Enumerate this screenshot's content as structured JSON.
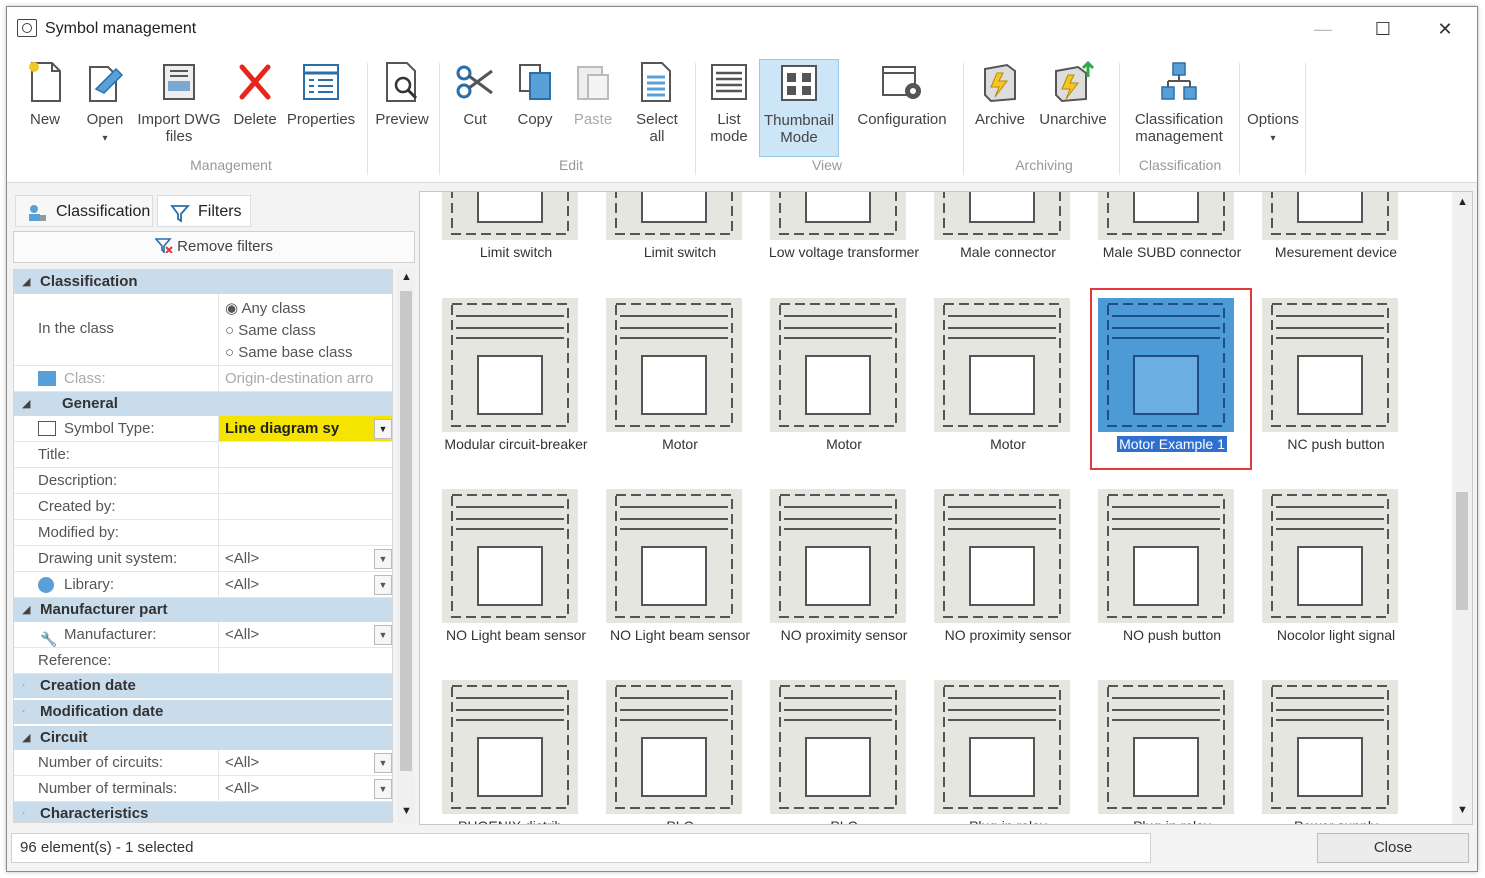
{
  "window": {
    "title": "Symbol management",
    "minimize": "—",
    "maximize": "☐",
    "close": "✕"
  },
  "ribbon": {
    "buttons": [
      {
        "label": "New",
        "icon": "new-file-icon"
      },
      {
        "label": "Open",
        "icon": "open-icon",
        "dropdown": "▾"
      },
      {
        "label": "Import DWG files",
        "icon": "import-dwg-icon"
      },
      {
        "label": "Delete",
        "icon": "delete-icon"
      },
      {
        "label": "Properties",
        "icon": "properties-icon"
      },
      {
        "label": "Preview",
        "icon": "preview-icon"
      },
      {
        "label": "Cut",
        "icon": "scissors-icon"
      },
      {
        "label": "Copy",
        "icon": "copy-icon"
      },
      {
        "label": "Paste",
        "icon": "paste-icon"
      },
      {
        "label": "Select all",
        "icon": "select-all-icon"
      },
      {
        "label": "List mode",
        "icon": "list-mode-icon"
      },
      {
        "label": "Thumbnail Mode",
        "icon": "thumbnail-mode-icon"
      },
      {
        "label": "Configuration",
        "icon": "configuration-icon"
      },
      {
        "label": "Archive",
        "icon": "archive-icon"
      },
      {
        "label": "Unarchive",
        "icon": "unarchive-icon"
      },
      {
        "label": "Classification management",
        "icon": "classification-icon"
      },
      {
        "label": "Options",
        "icon": "options-icon",
        "dropdown": "▾"
      }
    ],
    "groups": [
      "Management",
      "Edit",
      "View",
      "Archiving",
      "Classification"
    ]
  },
  "left": {
    "tabs": [
      "Classification",
      "Filters"
    ],
    "remove_filters": "Remove filters",
    "sections": {
      "classification": "Classification",
      "general": "General",
      "manufacturer_part": "Manufacturer part",
      "creation_date": "Creation date",
      "modification_date": "Modification date",
      "circuit": "Circuit",
      "characteristics": "Characteristics"
    },
    "in_the_class": "In the class",
    "class_options": [
      "Any class",
      "Same class",
      "Same base class"
    ],
    "class_label": "Class:",
    "class_value": "Origin-destination arro",
    "symbol_type_label": "Symbol Type:",
    "symbol_type_value": "Line diagram sy",
    "fields": {
      "title": "Title:",
      "description": "Description:",
      "created_by": "Created by:",
      "modified_by": "Modified by:",
      "drawing_unit": "Drawing unit system:",
      "library": "Library:",
      "manufacturer": "Manufacturer:",
      "reference": "Reference:",
      "num_circuits": "Number of circuits:",
      "num_terminals": "Number of terminals:"
    },
    "all_value": "<All>"
  },
  "grid": {
    "rows": [
      [
        "Limit switch",
        "Limit switch",
        "Low voltage transformer",
        "Male connector",
        "Male SUBD connector",
        "Mesurement device"
      ],
      [
        "Modular circuit-breaker",
        "Motor",
        "Motor",
        "Motor",
        "Motor Example 1",
        "NC push button"
      ],
      [
        "NO Light beam sensor",
        "NO Light beam sensor",
        "NO proximity sensor",
        "NO proximity sensor",
        "NO push button",
        "Nocolor light signal"
      ],
      [
        "PHOENIX distrib...",
        "PLC",
        "PLC",
        "Plug-in relay",
        "Plug-in relay",
        "Power supply"
      ]
    ],
    "selected": "Motor Example 1"
  },
  "status": {
    "text": "96 element(s) - 1 selected",
    "close_label": "Close"
  },
  "colors": {
    "accent": "#4d9bd6",
    "selection_frame": "#e23a3a",
    "section_header": "#c9dcec",
    "symbol_type_highlight": "#f5e400"
  }
}
